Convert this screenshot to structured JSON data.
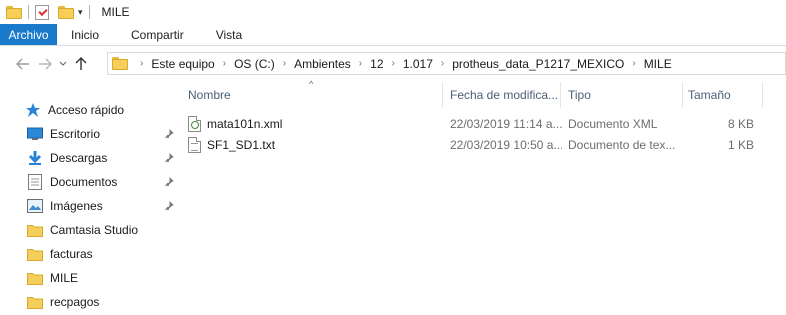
{
  "window": {
    "title": "MILE"
  },
  "ribbon": {
    "tabs": [
      {
        "label": "Archivo",
        "active": true
      },
      {
        "label": "Inicio"
      },
      {
        "label": "Compartir"
      },
      {
        "label": "Vista"
      }
    ]
  },
  "address": {
    "crumbs": [
      "Este equipo",
      "OS (C:)",
      "Ambientes",
      "12",
      "1.017",
      "protheus_data_P1217_MEXICO",
      "MILE"
    ]
  },
  "sidebar": {
    "items": [
      {
        "label": "Acceso rápido",
        "icon": "star-icon",
        "pinned": false
      },
      {
        "label": "Escritorio",
        "icon": "desktop-icon",
        "pinned": true
      },
      {
        "label": "Descargas",
        "icon": "download-icon",
        "pinned": true
      },
      {
        "label": "Documentos",
        "icon": "documents-icon",
        "pinned": true
      },
      {
        "label": "Imágenes",
        "icon": "pictures-icon",
        "pinned": true
      },
      {
        "label": "Camtasia Studio",
        "icon": "folder-icon",
        "pinned": false
      },
      {
        "label": "facturas",
        "icon": "folder-icon",
        "pinned": false
      },
      {
        "label": "MILE",
        "icon": "folder-icon",
        "pinned": false
      },
      {
        "label": "recpagos",
        "icon": "folder-icon",
        "pinned": false
      }
    ]
  },
  "columns": {
    "name": "Nombre",
    "date": "Fecha de modifica...",
    "type": "Tipo",
    "size": "Tamaño"
  },
  "files": [
    {
      "name": "mata101n.xml",
      "date": "22/03/2019 11:14 a...",
      "type": "Documento XML",
      "size": "8 KB",
      "icon": "xml-file-icon"
    },
    {
      "name": "SF1_SD1.txt",
      "date": "22/03/2019 10:50 a...",
      "type": "Documento de tex...",
      "size": "1 KB",
      "icon": "text-file-icon"
    }
  ],
  "colors": {
    "accent": "#1979ca",
    "folder": "#f6cf5a",
    "header_text": "#4c607a"
  }
}
